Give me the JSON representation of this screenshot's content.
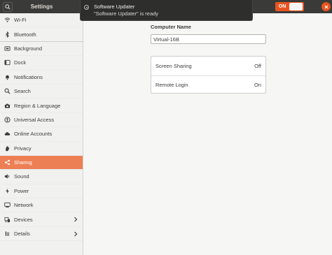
{
  "header": {
    "title": "Settings",
    "toggle_label": "ON"
  },
  "notification": {
    "title": "Software Updater",
    "body": "\"Software Updater\" is ready"
  },
  "sidebar": {
    "items": [
      {
        "label": "Wi-Fi",
        "icon": "wifi-icon"
      },
      {
        "label": "Bluetooth",
        "icon": "bluetooth-icon"
      },
      {
        "label": "Background",
        "icon": "background-icon"
      },
      {
        "label": "Dock",
        "icon": "dock-icon"
      },
      {
        "label": "Notifications",
        "icon": "bell-icon"
      },
      {
        "label": "Search",
        "icon": "search-icon"
      },
      {
        "label": "Region & Language",
        "icon": "camera-icon"
      },
      {
        "label": "Universal Access",
        "icon": "universal-access-icon"
      },
      {
        "label": "Online Accounts",
        "icon": "cloud-icon"
      },
      {
        "label": "Privacy",
        "icon": "privacy-hand-icon"
      },
      {
        "label": "Sharing",
        "icon": "share-icon",
        "active": true
      },
      {
        "label": "Sound",
        "icon": "speaker-icon"
      },
      {
        "label": "Power",
        "icon": "power-icon"
      },
      {
        "label": "Network",
        "icon": "network-icon"
      },
      {
        "label": "Devices",
        "icon": "devices-icon",
        "has_children": true
      },
      {
        "label": "Details",
        "icon": "info-icon",
        "has_children": true
      }
    ]
  },
  "main": {
    "computer_name_label": "Computer Name",
    "computer_name_value": "Virtual-16B",
    "services": [
      {
        "label": "Screen Sharing",
        "status": "Off"
      },
      {
        "label": "Remote Login",
        "status": "On"
      }
    ]
  },
  "colors": {
    "accent": "#e95420",
    "active_row": "#ed7f55",
    "headerbar": "#3a3a38"
  }
}
